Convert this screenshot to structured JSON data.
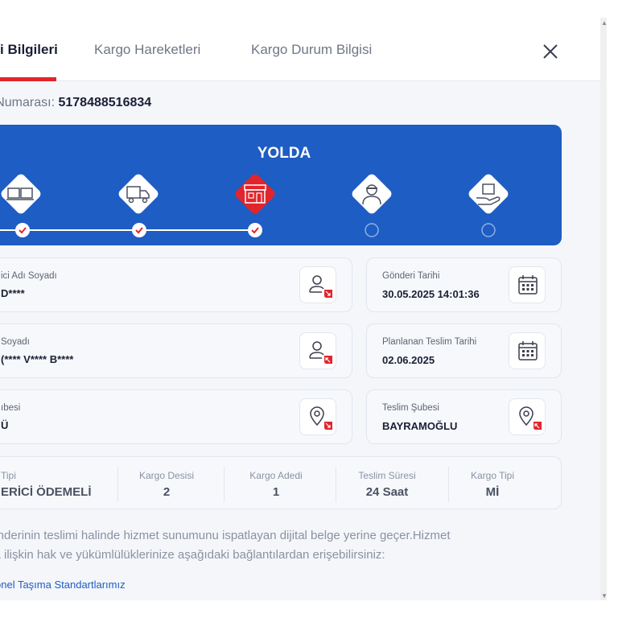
{
  "tabs": [
    {
      "label": "i Bilgileri",
      "active": true
    },
    {
      "label": "Kargo Hareketleri",
      "active": false
    },
    {
      "label": "Kargo Durum Bilgisi",
      "active": false
    }
  ],
  "close_icon": "close-icon",
  "tracking": {
    "label": "eri Numarası:",
    "number": "5178488516834"
  },
  "status": {
    "title": "YOLDA",
    "steps": [
      {
        "icon": "boxes-icon",
        "done": true
      },
      {
        "icon": "truck-icon",
        "done": true
      },
      {
        "icon": "branch-store-icon",
        "done": true,
        "current": true
      },
      {
        "icon": "courier-icon",
        "done": false
      },
      {
        "icon": "hand-package-icon",
        "done": false
      }
    ]
  },
  "cards": {
    "sender_name": {
      "label": "ici Adı Soyadı",
      "value": "D****",
      "icon": "user-outgoing-icon"
    },
    "send_date": {
      "label": "Gönderi Tarihi",
      "value": "30.05.2025 14:01:36",
      "icon": "calendar-icon"
    },
    "receiver_name": {
      "label": "Soyadı",
      "value": "(**** V**** B****",
      "icon": "user-incoming-icon"
    },
    "planned_date": {
      "label": "Planlanan Teslim Tarihi",
      "value": "02.06.2025",
      "icon": "calendar-icon"
    },
    "sender_branch": {
      "label": "ıbesi",
      "value": "Ü",
      "icon": "location-outgoing-icon"
    },
    "delivery_branch": {
      "label": "Teslim Şubesi",
      "value": "BAYRAMOĞLU",
      "icon": "location-incoming-icon"
    }
  },
  "summary": [
    {
      "label": "Tipi",
      "value": "ERİCİ ÖDEMELİ"
    },
    {
      "label": "Kargo Desisi",
      "value": "2"
    },
    {
      "label": "Kargo Adedi",
      "value": "1"
    },
    {
      "label": "Teslim Süresi",
      "value": "24 Saat"
    },
    {
      "label": "Kargo Tipi",
      "value": "Mİ"
    }
  ],
  "note": {
    "line1": "gönderinin teslimi halinde hizmet sunumunu ispatlayan dijital belge yerine geçer.Hizmet",
    "line2": "ma ilişkin hak ve yükümlülüklerinize aşağıdaki bağlantılardan erişebilirsiniz:"
  },
  "link": "onel Taşıma Standartlarımız",
  "colors": {
    "accent_red": "#e1252c",
    "brand_blue": "#1e5dc3",
    "text_dark": "#1a1f36"
  }
}
